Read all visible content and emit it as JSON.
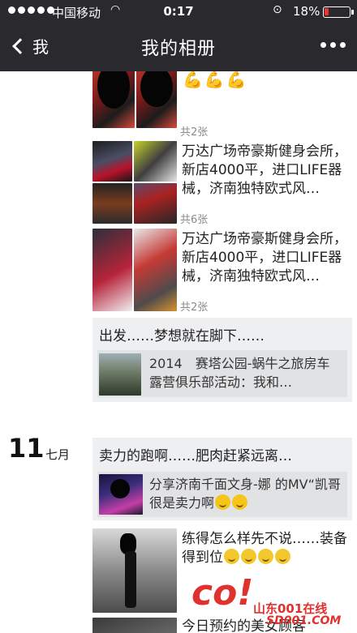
{
  "status_bar": {
    "carrier": "中国移动",
    "time": "0:17",
    "battery": "18%",
    "battery_level": 0.18
  },
  "nav": {
    "back_label": "我",
    "title": "我的相册"
  },
  "posts": [
    {
      "count": "共2张"
    },
    {
      "text": "万达广场帝豪斯健身会所，新店4000平，进口LIFE器械，济南独特欧式风…",
      "count": "共6张"
    },
    {
      "text": "万达广场帝豪斯健身会所，新店4000平，进口LIFE器械，济南独特欧式风…",
      "count": "共2张"
    },
    {
      "text": "出发……梦想就在脚下……",
      "link_text": "2014　赛塔公园-蜗牛之旅房车露营俱乐部活动：我和…"
    }
  ],
  "date_group": {
    "day": "11",
    "month": "七月",
    "posts": [
      {
        "text": "卖力的跑啊……肥肉赶紧远离…",
        "link_text": "分享济南千面文身-娜 的MV“凯哥很是卖力啊"
      },
      {
        "text": "练得怎么样先不说……装备得到位"
      },
      {
        "text": "今日预约的美女顾客"
      }
    ]
  },
  "watermark": {
    "brand": "山东001在线",
    "site": "SD001.COM"
  }
}
